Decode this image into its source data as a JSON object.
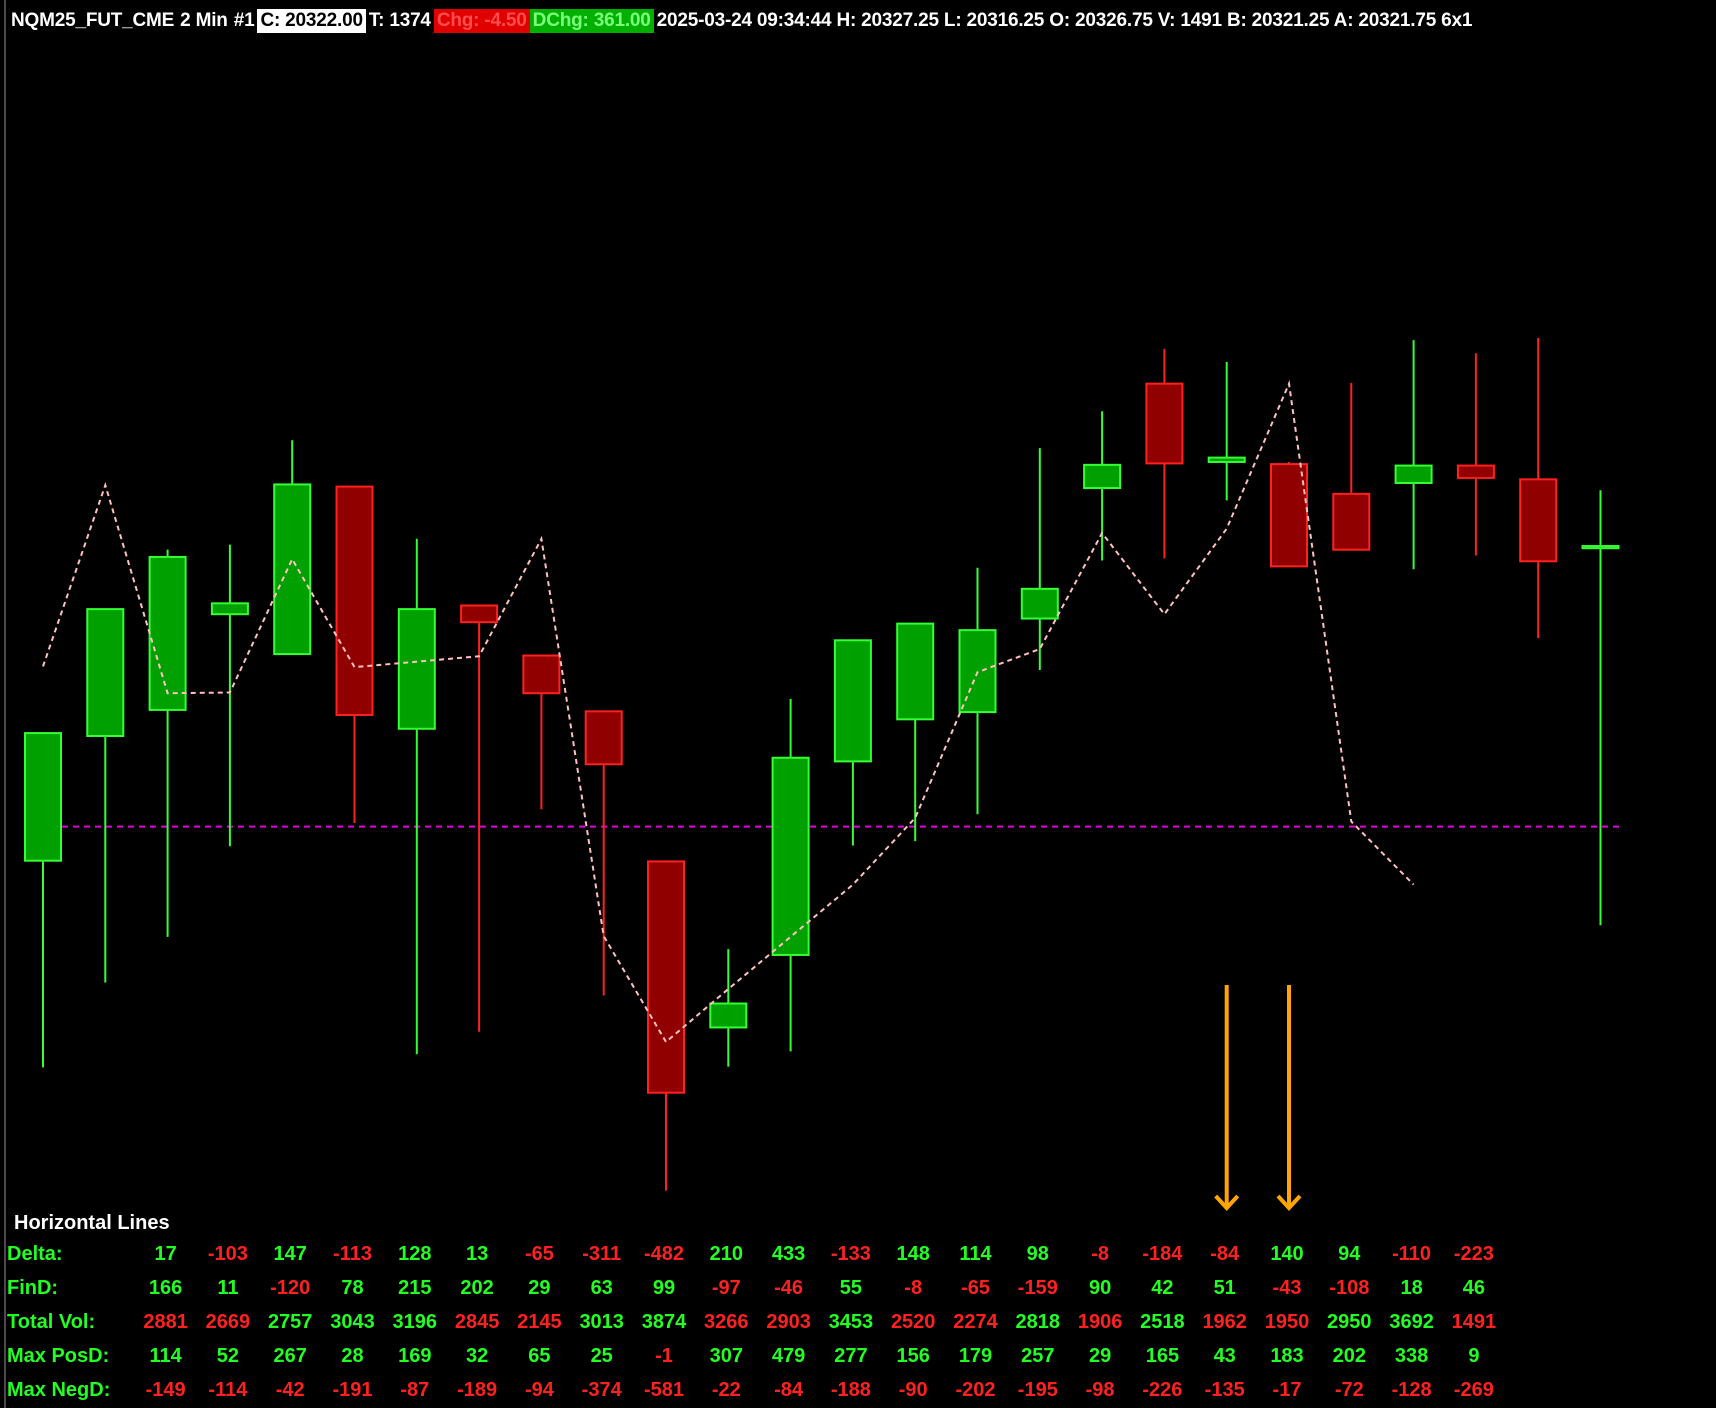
{
  "header": {
    "symbol": "NQM25_FUT_CME",
    "interval": "2 Min",
    "chart_num": "#1",
    "close": "C: 20322.00",
    "ticks": "T: 1374",
    "chg": "Chg: -4.50",
    "dchg": "DChg: 361.00",
    "rest": "2025-03-24 09:34:44 H: 20327.25 L: 20316.25 O: 20326.75 V: 1491 B: 20321.25 A: 20321.75 6x1"
  },
  "colors": {
    "up": "#00a000",
    "up_edge": "#33ff33",
    "down": "#900000",
    "down_edge": "#ff2020",
    "zigzag": "#ffc0c0",
    "hline": "#e000e0",
    "arrow": "#ffa500"
  },
  "chart_data": {
    "type": "candlestick",
    "scale": {
      "top_price": 160,
      "bottom_price": 0
    },
    "candles": [
      {
        "o": 46.8,
        "h": 48.8,
        "l": 18.3,
        "c": 64.4
      },
      {
        "o": 64.0,
        "h": 72.2,
        "l": 30.0,
        "c": 81.5
      },
      {
        "o": 67.6,
        "h": 89.7,
        "l": 36.3,
        "c": 88.7
      },
      {
        "o": 80.8,
        "h": 90.4,
        "l": 48.8,
        "c": 82.3
      },
      {
        "o": 75.3,
        "h": 104.8,
        "l": 75.3,
        "c": 98.7
      },
      {
        "o": 98.4,
        "h": 97.4,
        "l": 52.0,
        "c": 66.9
      },
      {
        "o": 65.0,
        "h": 91.2,
        "l": 20.1,
        "c": 81.5
      },
      {
        "o": 82.0,
        "h": 81.4,
        "l": 23.2,
        "c": 79.7
      },
      {
        "o": 75.1,
        "h": 68.8,
        "l": 53.9,
        "c": 69.9
      },
      {
        "o": 67.4,
        "h": 58.2,
        "l": 28.2,
        "c": 60.1
      },
      {
        "o": 46.7,
        "h": 23.7,
        "l": 1.3,
        "c": 14.8
      },
      {
        "o": 23.8,
        "h": 34.6,
        "l": 18.4,
        "c": 27.1
      },
      {
        "o": 33.8,
        "h": 69.1,
        "l": 20.5,
        "c": 61.0
      },
      {
        "o": 60.5,
        "h": 71.8,
        "l": 48.9,
        "c": 77.2
      },
      {
        "o": 66.3,
        "h": 78.1,
        "l": 49.5,
        "c": 79.5
      },
      {
        "o": 67.3,
        "h": 87.2,
        "l": 53.2,
        "c": 78.6
      },
      {
        "o": 80.2,
        "h": 103.7,
        "l": 73.1,
        "c": 84.3
      },
      {
        "o": 98.2,
        "h": 108.8,
        "l": 88.2,
        "c": 101.4
      },
      {
        "o": 112.6,
        "h": 117.4,
        "l": 88.5,
        "c": 101.6
      },
      {
        "o": 101.8,
        "h": 115.6,
        "l": 96.5,
        "c": 102.4
      },
      {
        "o": 101.5,
        "h": 101.8,
        "l": 95.3,
        "c": 87.4
      },
      {
        "o": 97.4,
        "h": 112.7,
        "l": 101.7,
        "c": 89.7
      },
      {
        "o": 98.9,
        "h": 118.6,
        "l": 87.0,
        "c": 101.3
      },
      {
        "o": 101.3,
        "h": 116.8,
        "l": 88.9,
        "c": 99.6
      },
      {
        "o": 99.4,
        "h": 118.9,
        "l": 77.5,
        "c": 88.1
      },
      {
        "o": 89.9,
        "h": 97.9,
        "l": 37.9,
        "c": 90.2
      }
    ],
    "zigzag": [
      {
        "bar": 0,
        "p": 73.6
      },
      {
        "bar": 1,
        "p": 98.6
      },
      {
        "bar": 2,
        "p": 69.9
      },
      {
        "bar": 3,
        "p": 70.0
      },
      {
        "bar": 4,
        "p": 88.4
      },
      {
        "bar": 5,
        "p": 73.5
      },
      {
        "bar": 7,
        "p": 75.0
      },
      {
        "bar": 8,
        "p": 91.2
      },
      {
        "bar": 9,
        "p": 36.4
      },
      {
        "bar": 10,
        "p": 21.8
      },
      {
        "bar": 11,
        "p": 29.1
      },
      {
        "bar": 13,
        "p": 43.5
      },
      {
        "bar": 14,
        "p": 52.7
      },
      {
        "bar": 15,
        "p": 72.8
      },
      {
        "bar": 16,
        "p": 76.0
      },
      {
        "bar": 17,
        "p": 92.0
      },
      {
        "bar": 18,
        "p": 80.8
      },
      {
        "bar": 19,
        "p": 92.6
      },
      {
        "bar": 20,
        "p": 112.6
      },
      {
        "bar": 21,
        "p": 52.2
      },
      {
        "bar": 22,
        "p": 43.5
      }
    ],
    "hline": 51.5,
    "arrows": [
      19,
      20
    ],
    "table": {
      "title": "Horizontal Lines",
      "rows": [
        {
          "label": "Delta:",
          "values": [
            17,
            -103,
            147,
            -113,
            128,
            13,
            -65,
            -311,
            -482,
            210,
            433,
            -133,
            148,
            114,
            98,
            -8,
            -184,
            -84,
            140,
            94,
            -110,
            -223
          ]
        },
        {
          "label": "FinD:",
          "values": [
            166,
            11,
            -120,
            78,
            215,
            202,
            29,
            63,
            99,
            -97,
            -46,
            55,
            -8,
            -65,
            -159,
            90,
            42,
            51,
            -43,
            -108,
            18,
            46
          ]
        },
        {
          "label": "Total Vol:",
          "values": [
            2881,
            2669,
            2757,
            3043,
            3196,
            2845,
            2145,
            3013,
            3874,
            3266,
            2903,
            3453,
            2520,
            2274,
            2818,
            1906,
            2518,
            1962,
            1950,
            2950,
            3692,
            1491
          ],
          "colors": [
            "neg",
            "neg",
            "pos",
            "pos",
            "pos",
            "neg",
            "neg",
            "pos",
            "pos",
            "neg",
            "neg",
            "pos",
            "neg",
            "neg",
            "pos",
            "neg",
            "pos",
            "neg",
            "neg",
            "pos",
            "pos",
            "neg"
          ]
        },
        {
          "label": "Max PosD:",
          "values": [
            114,
            52,
            267,
            28,
            169,
            32,
            65,
            25,
            -1,
            307,
            479,
            277,
            156,
            179,
            257,
            29,
            165,
            43,
            183,
            202,
            338,
            9
          ]
        },
        {
          "label": "Max NegD:",
          "values": [
            -149,
            -114,
            -42,
            -191,
            -87,
            -189,
            -94,
            -374,
            -581,
            -22,
            -84,
            -188,
            -90,
            -202,
            -195,
            -98,
            -226,
            -135,
            -17,
            -72,
            -128,
            -269
          ]
        }
      ]
    }
  }
}
